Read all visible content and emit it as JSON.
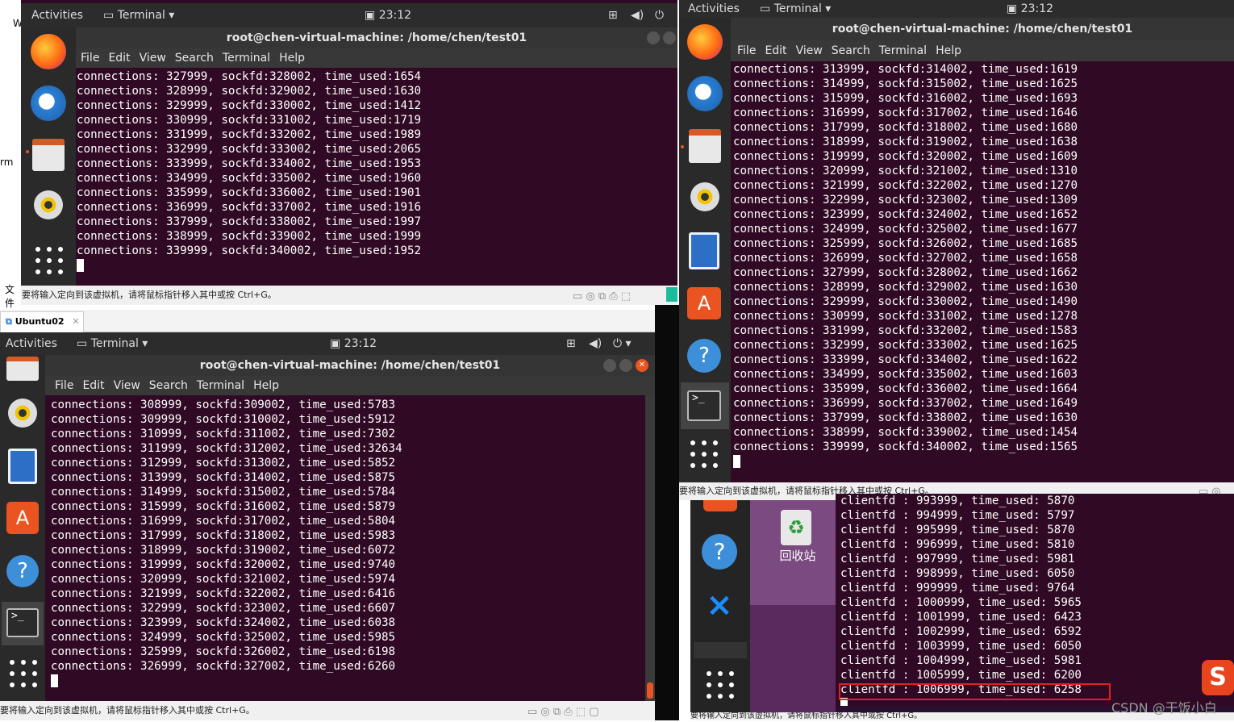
{
  "vm1": {
    "topbar": {
      "activities": "Activities",
      "app": "Terminal ▾",
      "time": "23:12"
    },
    "title": "root@chen-virtual-machine: /home/chen/test01",
    "menu": [
      "File",
      "Edit",
      "View",
      "Search",
      "Terminal",
      "Help"
    ],
    "lines": [
      "connections: 327999, sockfd:328002, time_used:1654",
      "connections: 328999, sockfd:329002, time_used:1630",
      "connections: 329999, sockfd:330002, time_used:1412",
      "connections: 330999, sockfd:331002, time_used:1719",
      "connections: 331999, sockfd:332002, time_used:1989",
      "connections: 332999, sockfd:333002, time_used:2065",
      "connections: 333999, sockfd:334002, time_used:1953",
      "connections: 334999, sockfd:335002, time_used:1960",
      "connections: 335999, sockfd:336002, time_used:1901",
      "connections: 336999, sockfd:337002, time_used:1916",
      "connections: 337999, sockfd:338002, time_used:1997",
      "connections: 338999, sockfd:339002, time_used:1999",
      "connections: 339999, sockfd:340002, time_used:1952"
    ],
    "status": "要将输入定向到该虚拟机，请将鼠标指针移入其中或按 Ctrl+G。"
  },
  "vm2": {
    "tab": "Ubuntu02",
    "topbar": {
      "activities": "Activities",
      "app": "Terminal ▾",
      "time": "23:12"
    },
    "title": "root@chen-virtual-machine: /home/chen/test01",
    "menu": [
      "File",
      "Edit",
      "View",
      "Search",
      "Terminal",
      "Help"
    ],
    "lines": [
      "connections: 308999, sockfd:309002, time_used:5783",
      "connections: 309999, sockfd:310002, time_used:5912",
      "connections: 310999, sockfd:311002, time_used:7302",
      "connections: 311999, sockfd:312002, time_used:32634",
      "connections: 312999, sockfd:313002, time_used:5852",
      "connections: 313999, sockfd:314002, time_used:5875",
      "connections: 314999, sockfd:315002, time_used:5784",
      "connections: 315999, sockfd:316002, time_used:5879",
      "connections: 316999, sockfd:317002, time_used:5804",
      "connections: 317999, sockfd:318002, time_used:5983",
      "connections: 318999, sockfd:319002, time_used:6072",
      "connections: 319999, sockfd:320002, time_used:9740",
      "connections: 320999, sockfd:321002, time_used:5974",
      "connections: 321999, sockfd:322002, time_used:6416",
      "connections: 322999, sockfd:323002, time_used:6607",
      "connections: 323999, sockfd:324002, time_used:6038",
      "connections: 324999, sockfd:325002, time_used:5985",
      "connections: 325999, sockfd:326002, time_used:6198",
      "connections: 326999, sockfd:327002, time_used:6260"
    ],
    "status": "要将输入定向到该虚拟机，请将鼠标指针移入其中或按 Ctrl+G。"
  },
  "vm3": {
    "topbar": {
      "activities": "Activities",
      "app": "Terminal ▾",
      "time": "23:12"
    },
    "title": "root@chen-virtual-machine: /home/chen/test01",
    "menu": [
      "File",
      "Edit",
      "View",
      "Search",
      "Terminal",
      "Help"
    ],
    "lines": [
      "connections: 313999, sockfd:314002, time_used:1619",
      "connections: 314999, sockfd:315002, time_used:1625",
      "connections: 315999, sockfd:316002, time_used:1693",
      "connections: 316999, sockfd:317002, time_used:1646",
      "connections: 317999, sockfd:318002, time_used:1680",
      "connections: 318999, sockfd:319002, time_used:1638",
      "connections: 319999, sockfd:320002, time_used:1609",
      "connections: 320999, sockfd:321002, time_used:1310",
      "connections: 321999, sockfd:322002, time_used:1270",
      "connections: 322999, sockfd:323002, time_used:1309",
      "connections: 323999, sockfd:324002, time_used:1652",
      "connections: 324999, sockfd:325002, time_used:1677",
      "connections: 325999, sockfd:326002, time_used:1685",
      "connections: 326999, sockfd:327002, time_used:1658",
      "connections: 327999, sockfd:328002, time_used:1662",
      "connections: 328999, sockfd:329002, time_used:1630",
      "connections: 329999, sockfd:330002, time_used:1490",
      "connections: 330999, sockfd:331002, time_used:1278",
      "connections: 331999, sockfd:332002, time_used:1583",
      "connections: 332999, sockfd:333002, time_used:1625",
      "connections: 333999, sockfd:334002, time_used:1622",
      "connections: 334999, sockfd:335002, time_used:1603",
      "connections: 335999, sockfd:336002, time_used:1664",
      "connections: 336999, sockfd:337002, time_used:1649",
      "connections: 337999, sockfd:338002, time_used:1630",
      "connections: 338999, sockfd:339002, time_used:1454",
      "connections: 339999, sockfd:340002, time_used:1565"
    ],
    "status": "要将输入定向到该虚拟机，请将鼠标指针移入其中或按 Ctrl+G。"
  },
  "vm4": {
    "recycle_label": "回收站",
    "lines": [
      "clientfd : 993999, time_used: 5870",
      "clientfd : 994999, time_used: 5797",
      "clientfd : 995999, time_used: 5870",
      "clientfd : 996999, time_used: 5810",
      "clientfd : 997999, time_used: 5981",
      "clientfd : 998999, time_used: 6050",
      "clientfd : 999999, time_used: 9764",
      "clientfd : 1000999, time_used: 5965",
      "clientfd : 1001999, time_used: 6423",
      "clientfd : 1002999, time_used: 6592",
      "clientfd : 1003999, time_used: 6050",
      "clientfd : 1004999, time_used: 5981",
      "clientfd : 1005999, time_used: 6200",
      "clientfd : 1006999, time_used: 6258"
    ],
    "status_partial": "要将输入定向到该虚拟机，请将鼠标指针移入其中或按 Ctrl+G。"
  },
  "left_fragments": {
    "w": "W",
    "rm": "rm",
    "wen": "文件"
  },
  "watermark": "CSDN @干饭小白",
  "colors": {
    "terminal_bg": "#300a24",
    "highlight_box": "#e02020",
    "ubuntu_orange": "#e95420"
  }
}
